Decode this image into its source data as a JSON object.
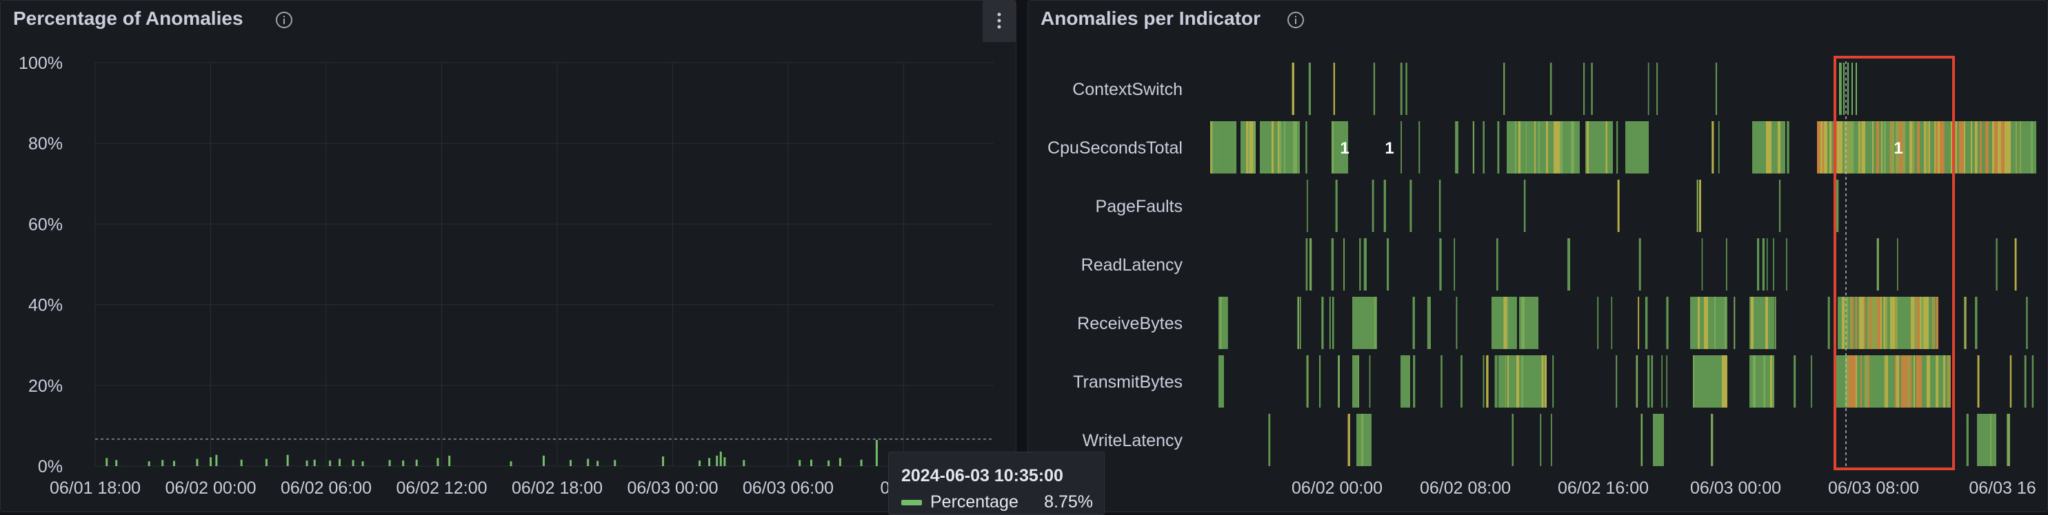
{
  "left_panel": {
    "title": "Percentage of Anomalies",
    "chart_data": {
      "type": "bar",
      "ylabel": "",
      "xlabel": "",
      "y_ticks": [
        "100%",
        "80%",
        "60%",
        "40%",
        "20%",
        "0%"
      ],
      "ylim": [
        0,
        100
      ],
      "x_ticks": [
        "06/01 18:00",
        "06/02 00:00",
        "06/02 06:00",
        "06/02 12:00",
        "06/02 18:00",
        "06/03 00:00",
        "06/03 06:00",
        "06/0"
      ],
      "series": [
        {
          "name": "Percentage",
          "color": "#73bf69",
          "points": [
            {
              "t": 0.6,
              "v": 2.0
            },
            {
              "t": 1.1,
              "v": 1.5
            },
            {
              "t": 2.8,
              "v": 1.2
            },
            {
              "t": 3.5,
              "v": 1.5
            },
            {
              "t": 4.1,
              "v": 1.3
            },
            {
              "t": 5.3,
              "v": 1.8
            },
            {
              "t": 6.0,
              "v": 2.2
            },
            {
              "t": 6.3,
              "v": 2.8
            },
            {
              "t": 7.6,
              "v": 1.6
            },
            {
              "t": 8.9,
              "v": 1.8
            },
            {
              "t": 10.0,
              "v": 2.8
            },
            {
              "t": 11.0,
              "v": 1.4
            },
            {
              "t": 11.4,
              "v": 1.6
            },
            {
              "t": 12.2,
              "v": 1.4
            },
            {
              "t": 12.7,
              "v": 1.8
            },
            {
              "t": 13.4,
              "v": 1.5
            },
            {
              "t": 13.9,
              "v": 1.2
            },
            {
              "t": 15.3,
              "v": 1.5
            },
            {
              "t": 16.0,
              "v": 1.4
            },
            {
              "t": 16.7,
              "v": 1.6
            },
            {
              "t": 17.8,
              "v": 2.0
            },
            {
              "t": 18.4,
              "v": 2.6
            },
            {
              "t": 21.6,
              "v": 1.2
            },
            {
              "t": 23.3,
              "v": 2.6
            },
            {
              "t": 24.7,
              "v": 1.5
            },
            {
              "t": 25.6,
              "v": 1.8
            },
            {
              "t": 26.1,
              "v": 1.3
            },
            {
              "t": 27.0,
              "v": 1.5
            },
            {
              "t": 29.5,
              "v": 2.4
            },
            {
              "t": 31.4,
              "v": 1.4
            },
            {
              "t": 31.9,
              "v": 2.0
            },
            {
              "t": 32.3,
              "v": 2.6
            },
            {
              "t": 32.5,
              "v": 3.6
            },
            {
              "t": 32.7,
              "v": 2.2
            },
            {
              "t": 33.7,
              "v": 1.5
            },
            {
              "t": 36.6,
              "v": 1.5
            },
            {
              "t": 37.2,
              "v": 1.6
            },
            {
              "t": 38.1,
              "v": 1.4
            },
            {
              "t": 38.7,
              "v": 2.0
            },
            {
              "t": 39.8,
              "v": 1.6
            },
            {
              "t": 40.6,
              "v": 6.5
            },
            {
              "t": 41.4,
              "v": 1.8
            },
            {
              "t": 43.0,
              "v": 1.2
            },
            {
              "t": 44.5,
              "v": 1.8
            },
            {
              "t": 45.6,
              "v": 1.5
            },
            {
              "t": 45.9,
              "v": 3.0
            },
            {
              "t": 46.3,
              "v": 3.2
            },
            {
              "t": 48.0,
              "v": 1.3
            },
            {
              "t": 49.0,
              "v": 2.8
            },
            {
              "t": 49.3,
              "v": 8.75
            },
            {
              "t": 49.7,
              "v": 3.6
            }
          ]
        }
      ],
      "hover_value_pct": 8.75
    },
    "tooltip": {
      "time": "2024-06-03 10:35:00",
      "series": "Percentage",
      "value": "8.75%"
    }
  },
  "right_panel": {
    "title": "Anomalies per Indicator",
    "chart_data": {
      "type": "heatmap",
      "rows": [
        "ContextSwitch",
        "CpuSecondsTotal",
        "PageFaults",
        "ReadLatency",
        "ReceiveBytes",
        "TransmitBytes",
        "WriteLatency"
      ],
      "x_ticks": [
        "06/02 00:00",
        "06/02 08:00",
        "06/02 16:00",
        "06/03 00:00",
        "06/03 08:00",
        "06/03 16"
      ],
      "cell_labels": [
        "1",
        "1",
        "1"
      ]
    }
  },
  "colors": {
    "anomaly_green": "#73bf69",
    "anomaly_green_dark": "#5f9550",
    "anomaly_yellow": "#b5ad47",
    "anomaly_orange": "#c3823d",
    "highlight_box": "#e0432f"
  },
  "icons": [
    "info-icon",
    "menu-dots-icon"
  ]
}
